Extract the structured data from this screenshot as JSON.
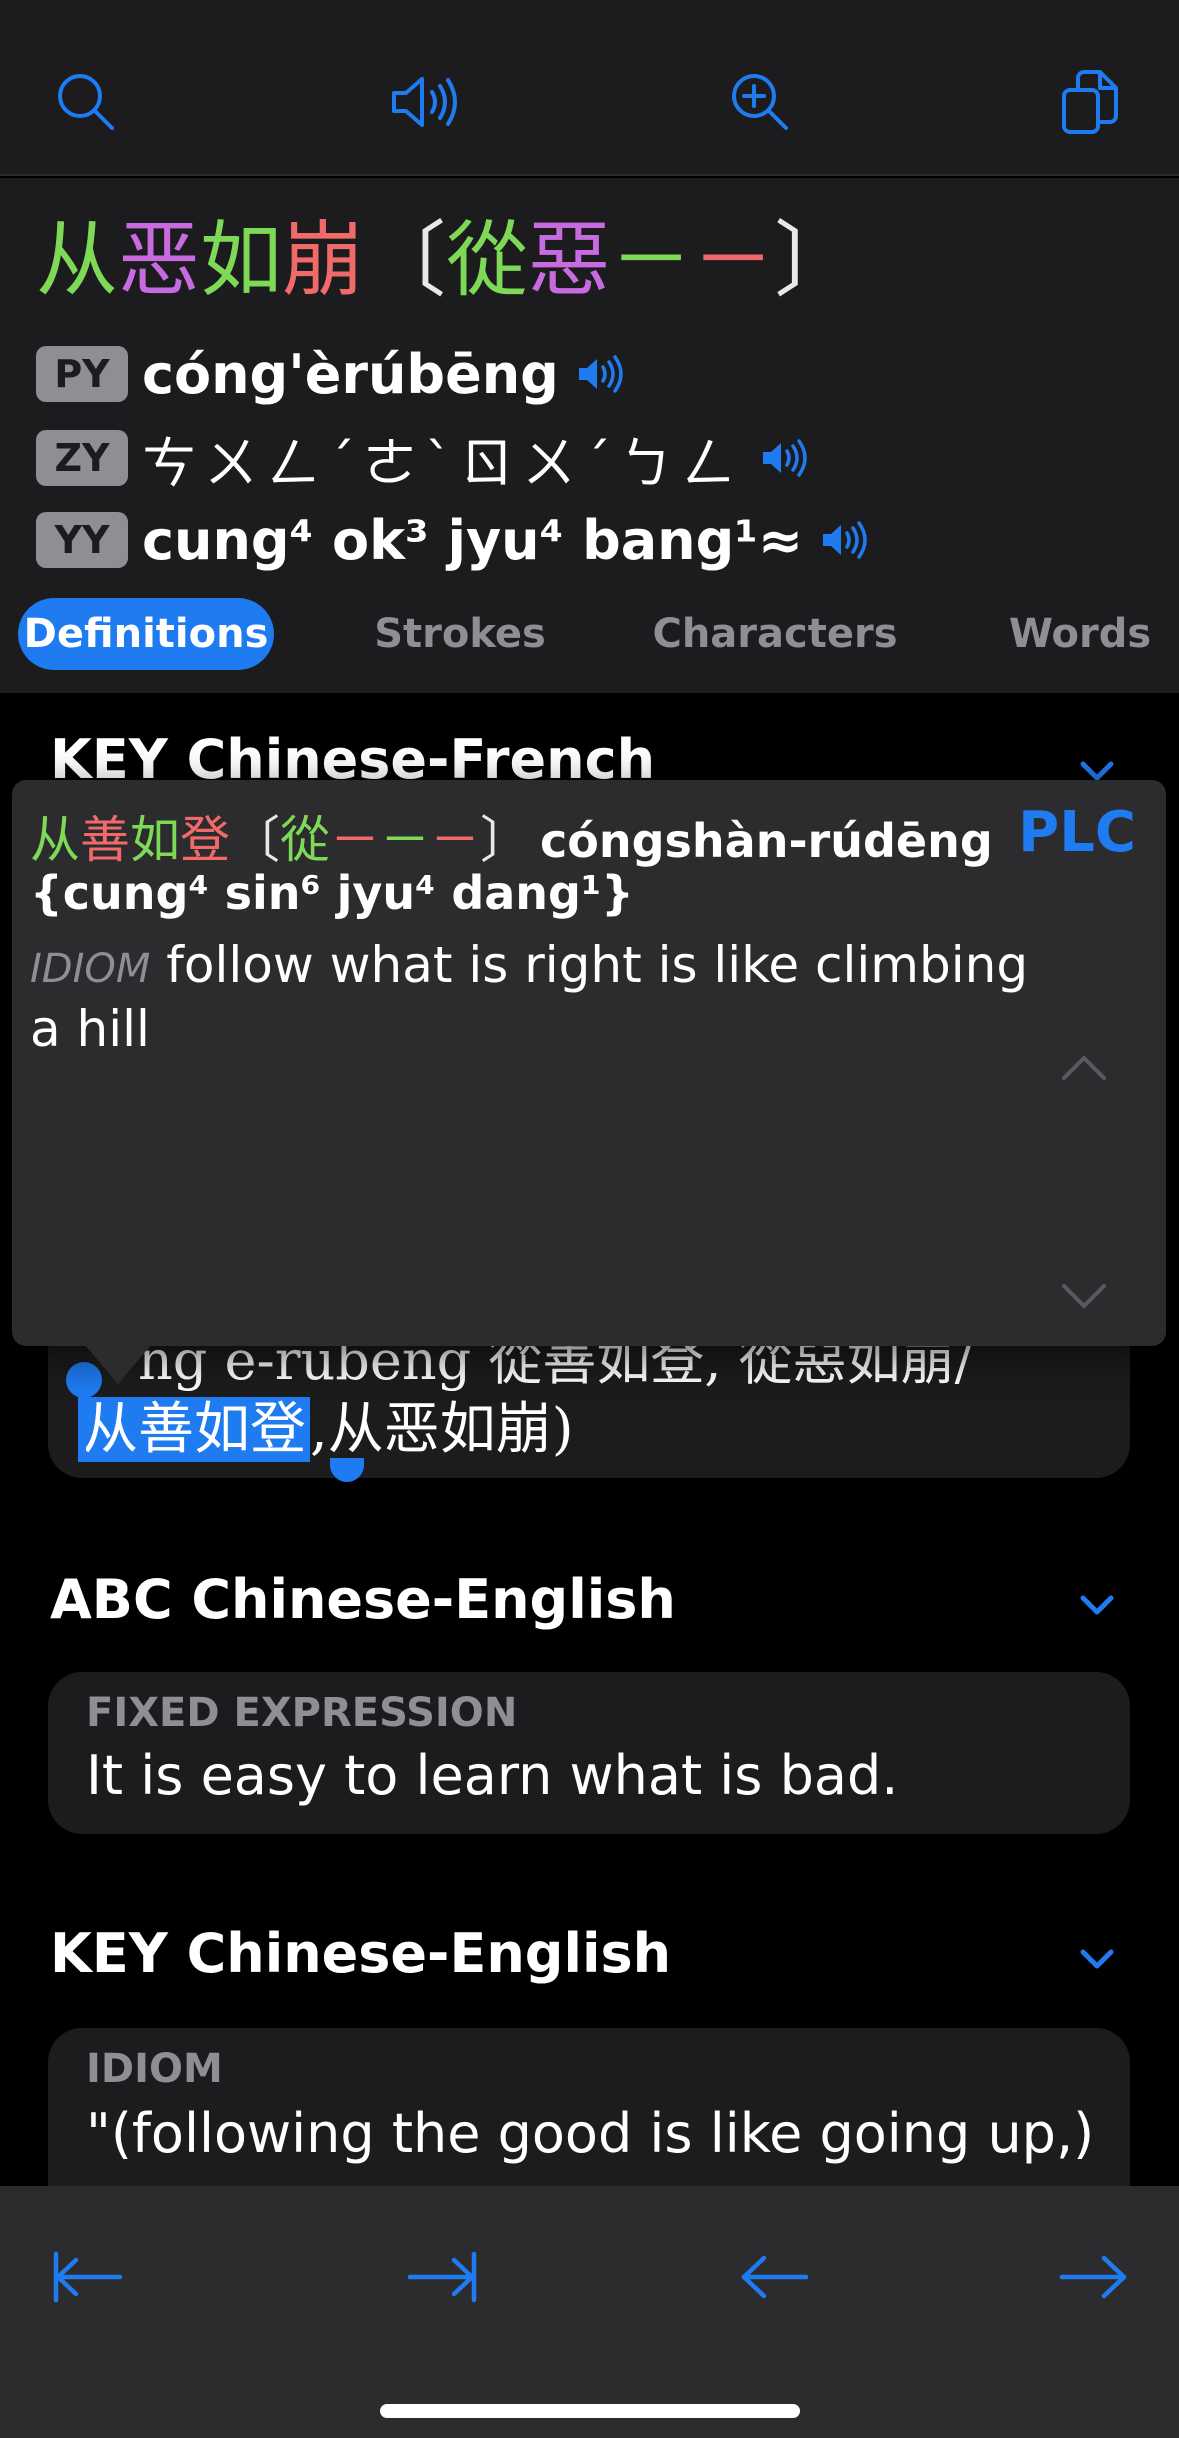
{
  "toolbar": {
    "icons": [
      "search-icon",
      "speaker-icon",
      "zoom-in-icon",
      "copy-icon"
    ]
  },
  "headword": {
    "simplified": [
      {
        "char": "从",
        "color": "#7ed957"
      },
      {
        "char": "恶",
        "color": "#c86be0"
      },
      {
        "char": "如",
        "color": "#7ed957"
      },
      {
        "char": "崩",
        "color": "#f06a6a"
      }
    ],
    "bracket_open": "〔",
    "traditional": [
      {
        "char": "從",
        "color": "#7ed957"
      },
      {
        "char": "惡",
        "color": "#c86be0"
      },
      {
        "char": "－",
        "color": "#7ed957"
      },
      {
        "char": "－",
        "color": "#f06a6a"
      }
    ],
    "bracket_close": "〕"
  },
  "pronunciations": {
    "py": {
      "badge": "PY",
      "text": "cóng'èrúbēng"
    },
    "zy": {
      "badge": "ZY",
      "text": "ㄘㄨㄥˊㄜˋㄖㄨˊㄅㄥ"
    },
    "yy": {
      "badge": "YY",
      "text": "cung⁴ ok³ jyu⁴ bang¹≈"
    }
  },
  "tabs": [
    {
      "label": "Definitions",
      "active": true
    },
    {
      "label": "Strokes",
      "active": false
    },
    {
      "label": "Characters",
      "active": false
    },
    {
      "label": "Words",
      "active": false
    }
  ],
  "sections": {
    "key_french": {
      "title": "KEY Chinese-French"
    },
    "abc_english": {
      "title": "ABC Chinese-English",
      "label": "FIXED EXPRESSION",
      "text": "It is easy to learn what is bad."
    },
    "key_english": {
      "title": "KEY Chinese-English",
      "label": "IDIOM",
      "text": "\"(following the good is like going up,)"
    }
  },
  "selection_card": {
    "line1": "ng e-rubeng 從善如登, 從惡如崩/",
    "highlighted": "从善如登",
    "line2_rest": ",从恶如崩)"
  },
  "popup": {
    "headword_simplified": [
      {
        "char": "从",
        "color": "#7ed957"
      },
      {
        "char": "善",
        "color": "#f06a6a"
      },
      {
        "char": "如",
        "color": "#7ed957"
      },
      {
        "char": "登",
        "color": "#f06a6a"
      }
    ],
    "bracket_open": "〔",
    "headword_traditional": [
      {
        "char": "從",
        "color": "#7ed957"
      },
      {
        "char": "－",
        "color": "#f06a6a"
      },
      {
        "char": "－",
        "color": "#7ed957"
      },
      {
        "char": "－",
        "color": "#f06a6a"
      }
    ],
    "bracket_close": "〕",
    "pinyin": "cóngshàn-rúdēng",
    "source": "PLC",
    "jyutping": "{cung⁴ sin⁶ jyu⁴ dang¹}",
    "pos": "IDIOM",
    "definition_line1": "follow what is right is like climbing",
    "definition_line2": "a hill"
  },
  "bottom_nav": {
    "icons": [
      "first-entry-icon",
      "last-entry-icon",
      "back-arrow-icon",
      "forward-arrow-icon"
    ]
  },
  "colors": {
    "accent": "#1e7bf0",
    "background": "#000000",
    "panel": "#1c1c1e"
  }
}
